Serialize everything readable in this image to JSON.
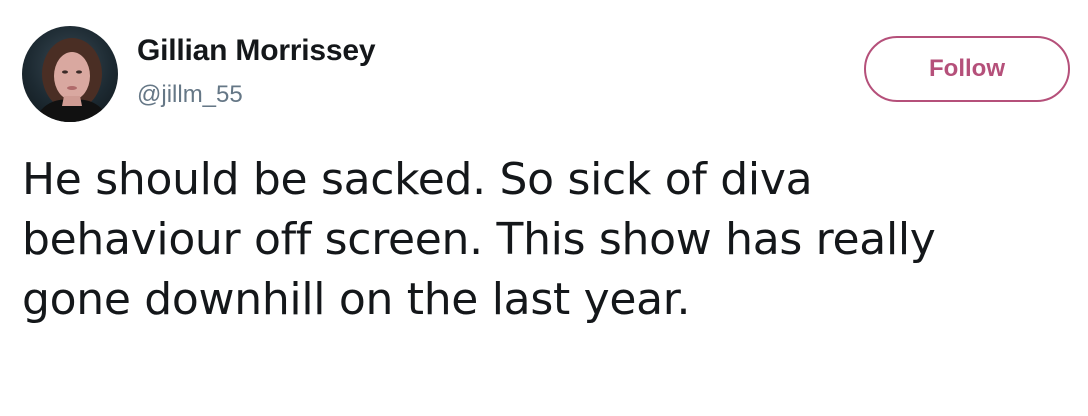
{
  "author": {
    "display_name": "Gillian Morrissey",
    "handle": "@jillm_55",
    "avatar_icon": "profile-photo"
  },
  "actions": {
    "follow_label": "Follow",
    "accent_color": "#b5507a"
  },
  "tweet": {
    "text": "He should be sacked. So sick of diva\nbehaviour off screen. This show has really\ngone downhill on the last year."
  }
}
